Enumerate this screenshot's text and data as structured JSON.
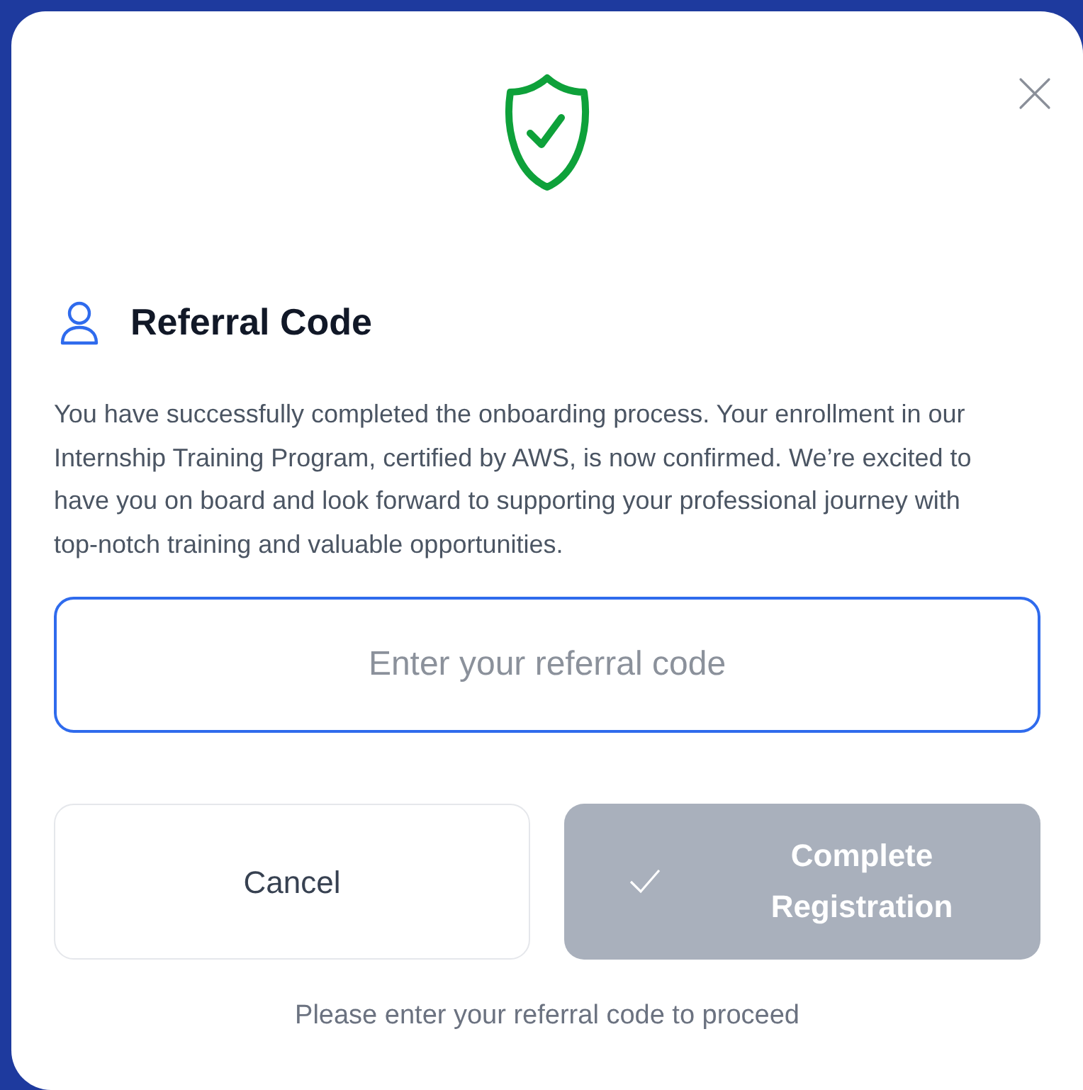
{
  "dialog": {
    "title": "Referral Code",
    "message": "You have successfully completed the onboarding process. Your enrollment in our Internship Training Program, certified by AWS, is now confirmed. We’re excited to have you on board and look forward to supporting your professional journey with top-notch training and valuable opportunities.",
    "referral_field": {
      "placeholder": "Enter your referral code",
      "focused": true
    },
    "buttons": [
      {
        "kind": "secondary",
        "label": "Cancel",
        "disabled": false
      },
      {
        "kind": "primary",
        "label": "Complete Registration",
        "disabled": true
      }
    ],
    "hint": "Please enter your referral code to proceed"
  }
}
